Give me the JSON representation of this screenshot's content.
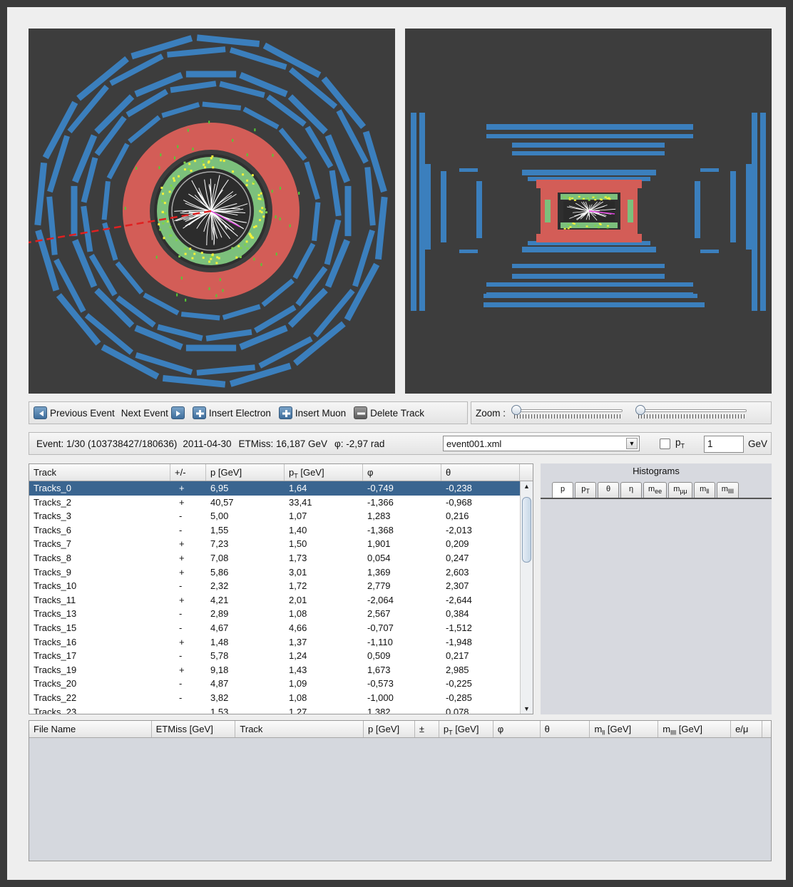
{
  "toolbar": {
    "previous_event": "Previous Event",
    "next_event": "Next Event",
    "insert_electron": "Insert Electron",
    "insert_muon": "Insert Muon",
    "delete_track": "Delete Track",
    "zoom_label": "Zoom :"
  },
  "info": {
    "event": "Event: 1/30 (103738427/180636)",
    "date": "2011-04-30",
    "etmiss": "ETMiss: 16,187 GeV",
    "phi": "φ: -2,97 rad",
    "file": "event001.xml",
    "pt_label": "p",
    "pt_sub": "T",
    "pt_value": "1",
    "pt_unit": "GeV"
  },
  "tracks": {
    "headers": [
      "Track",
      "+/-",
      "p [GeV]",
      "p",
      "φ",
      "θ"
    ],
    "pt_header_sub": "T",
    "pt_header_unit": " [GeV]",
    "rows": [
      [
        "Tracks_0",
        "+",
        "6,95",
        "1,64",
        "-0,749",
        "-0,238"
      ],
      [
        "Tracks_2",
        "+",
        "40,57",
        "33,41",
        "-1,366",
        "-0,968"
      ],
      [
        "Tracks_3",
        "-",
        "5,00",
        "1,07",
        "1,283",
        "0,216"
      ],
      [
        "Tracks_6",
        "-",
        "1,55",
        "1,40",
        "-1,368",
        "-2,013"
      ],
      [
        "Tracks_7",
        "+",
        "7,23",
        "1,50",
        "1,901",
        "0,209"
      ],
      [
        "Tracks_8",
        "+",
        "7,08",
        "1,73",
        "0,054",
        "0,247"
      ],
      [
        "Tracks_9",
        "+",
        "5,86",
        "3,01",
        "1,369",
        "2,603"
      ],
      [
        "Tracks_10",
        "-",
        "2,32",
        "1,72",
        "2,779",
        "2,307"
      ],
      [
        "Tracks_11",
        "+",
        "4,21",
        "2,01",
        "-2,064",
        "-2,644"
      ],
      [
        "Tracks_13",
        "-",
        "2,89",
        "1,08",
        "2,567",
        "0,384"
      ],
      [
        "Tracks_15",
        "-",
        "4,67",
        "4,66",
        "-0,707",
        "-1,512"
      ],
      [
        "Tracks_16",
        "+",
        "1,48",
        "1,37",
        "-1,110",
        "-1,948"
      ],
      [
        "Tracks_17",
        "-",
        "5,78",
        "1,24",
        "0,509",
        "0,217"
      ],
      [
        "Tracks_19",
        "+",
        "9,18",
        "1,43",
        "1,673",
        "2,985"
      ],
      [
        "Tracks_20",
        "-",
        "4,87",
        "1,09",
        "-0,573",
        "-0,225"
      ],
      [
        "Tracks_22",
        "-",
        "3,82",
        "1,08",
        "-1,000",
        "-0,285"
      ],
      [
        "Tracks_23",
        "",
        "1,53",
        "1,27",
        "1,382",
        "0,078"
      ]
    ]
  },
  "histograms": {
    "title": "Histograms",
    "tabs": [
      "p",
      "p",
      "θ",
      "η",
      "m",
      "m",
      "m",
      "m"
    ],
    "tab_subs": [
      "",
      "T",
      "",
      "",
      "ee",
      "μμ",
      "ll",
      "llll"
    ]
  },
  "selected": {
    "headers": [
      "File Name",
      "ETMiss [GeV]",
      "Track",
      "p [GeV]",
      "±",
      "p",
      "φ",
      "θ",
      "m",
      "m",
      "e/μ"
    ],
    "header_subs": [
      "",
      "",
      "",
      "",
      "",
      "T",
      "",
      "",
      "ll",
      "llll",
      ""
    ],
    "header_units": [
      "",
      "",
      "",
      "",
      "",
      " [GeV]",
      "",
      "",
      " [GeV]",
      " [GeV]",
      ""
    ]
  },
  "colors": {
    "background": "#3d3d3d",
    "muon_chamber": "#3b7fbd",
    "hadronic_calorimeter": "#d35d57",
    "em_calorimeter": "#7cc07c",
    "selection_blue": "#3a6590",
    "missing_et": "#e02020"
  }
}
